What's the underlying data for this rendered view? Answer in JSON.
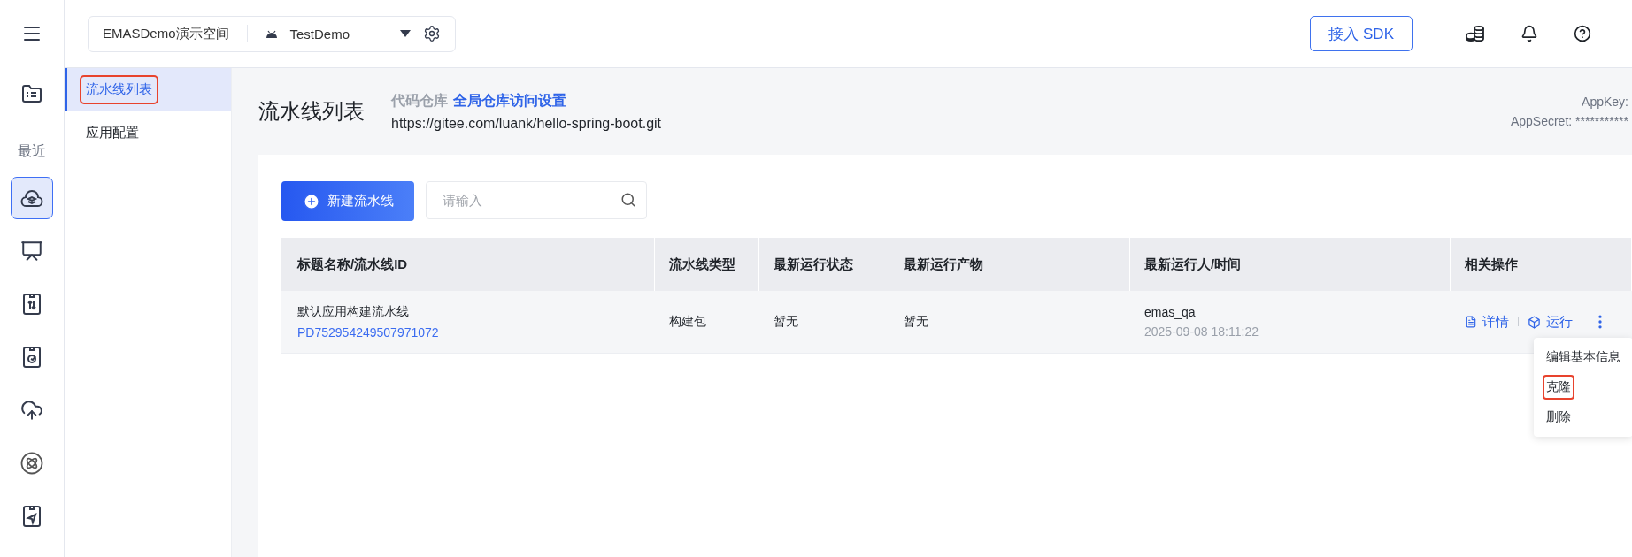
{
  "rail": {
    "top_items": [
      {
        "selected": false
      }
    ],
    "recent_label": "最近",
    "items": [
      {
        "selected": true
      },
      {
        "selected": false
      },
      {
        "selected": false
      },
      {
        "selected": false
      },
      {
        "selected": false
      },
      {
        "selected": false
      },
      {
        "selected": false
      }
    ]
  },
  "topbar": {
    "workspace": "EMASDemo演示空间",
    "app": "TestDemo",
    "sdk_button": "接入 SDK"
  },
  "sidebar": {
    "items": [
      {
        "label": "流水线列表",
        "selected": true,
        "highlighted": true
      },
      {
        "label": "应用配置",
        "selected": false,
        "highlighted": false
      }
    ]
  },
  "header": {
    "title": "流水线列表",
    "repo_label": "代码仓库",
    "repo_link": "全局仓库访问设置",
    "repo_url": "https://gitee.com/luank/hello-spring-boot.git",
    "appkey": "AppKey:",
    "appsecret": "AppSecret: ***********"
  },
  "toolbar": {
    "new_button": "新建流水线",
    "search_placeholder": "请输入"
  },
  "table": {
    "columns": [
      "标题名称/流水线ID",
      "流水线类型",
      "最新运行状态",
      "最新运行产物",
      "最新运行人/时间",
      "相关操作"
    ],
    "rows": [
      {
        "name": "默认应用构建流水线",
        "id": "PD752954249507971072",
        "type": "构建包",
        "status": "暂无",
        "artifact": "暂无",
        "runner": "emas_qa",
        "time": "2025-09-08 18:11:22",
        "actions": [
          "详情",
          "运行"
        ]
      }
    ]
  },
  "menu": {
    "items": [
      {
        "label": "编辑基本信息",
        "highlighted": false
      },
      {
        "label": "克隆",
        "highlighted": true
      },
      {
        "label": "删除",
        "highlighted": false
      }
    ]
  }
}
